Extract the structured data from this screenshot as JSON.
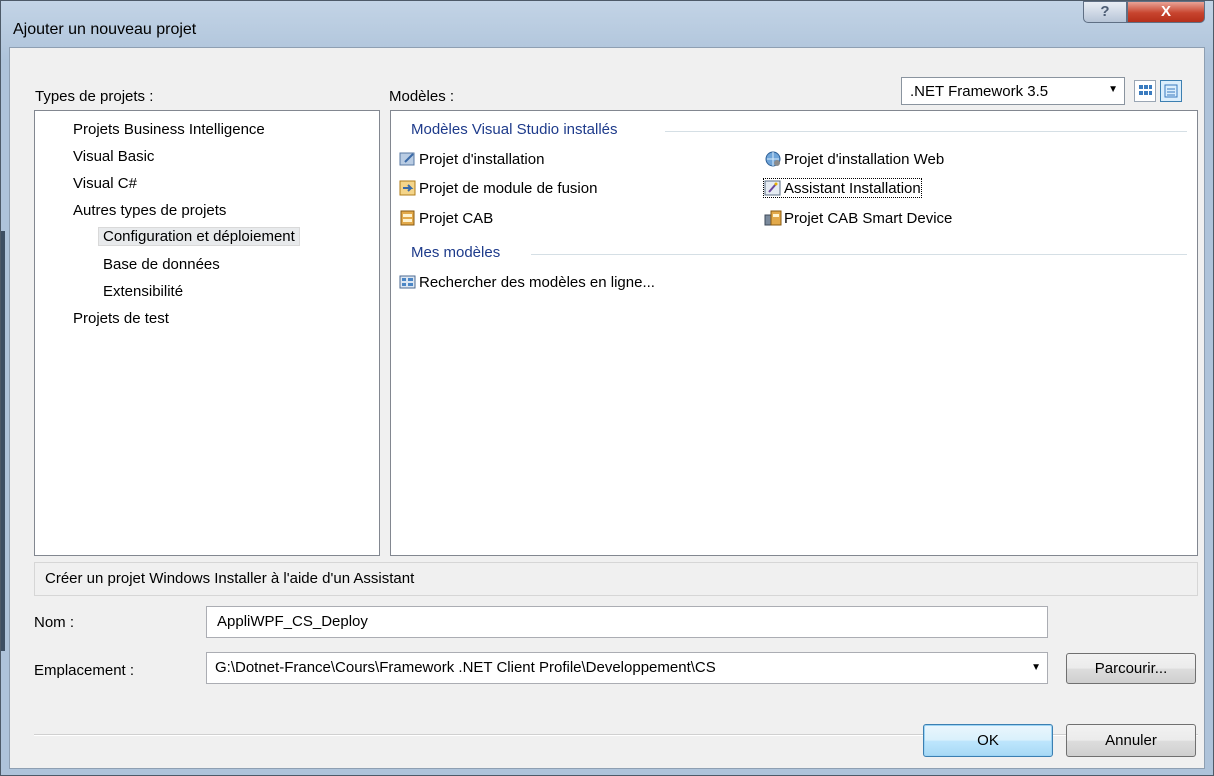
{
  "window": {
    "title": "Ajouter un nouveau projet"
  },
  "caption": {
    "help_glyph": "?",
    "close_glyph": "X"
  },
  "project_types": {
    "label": "Types de projets :",
    "items": [
      {
        "label": "Projets Business Intelligence"
      },
      {
        "label": "Visual Basic"
      },
      {
        "label": "Visual C#"
      },
      {
        "label": "Autres types de projets"
      },
      {
        "label": "Configuration et déploiement",
        "selected": true
      },
      {
        "label": "Base de données"
      },
      {
        "label": "Extensibilité"
      },
      {
        "label": "Projets de test"
      }
    ]
  },
  "templates": {
    "label": "Modèles :",
    "framework": ".NET Framework 3.5",
    "installed_header": "Modèles Visual Studio installés",
    "installed": [
      {
        "label": "Projet d'installation",
        "icon": "installer-project-icon"
      },
      {
        "label": "Projet d'installation Web",
        "icon": "web-setup-icon"
      },
      {
        "label": "Projet de module de fusion",
        "icon": "merge-module-icon"
      },
      {
        "label": "Assistant Installation",
        "icon": "setup-wizard-icon",
        "selected": true
      },
      {
        "label": "Projet CAB",
        "icon": "cab-project-icon"
      },
      {
        "label": "Projet CAB Smart Device",
        "icon": "smart-device-cab-icon"
      }
    ],
    "my_header": "Mes modèles",
    "my": [
      {
        "label": "Rechercher des modèles en ligne...",
        "icon": "online-templates-icon"
      }
    ]
  },
  "description": "Créer un projet Windows Installer à l'aide d'un Assistant",
  "form": {
    "name_label": "Nom :",
    "name_value": "AppliWPF_CS_Deploy",
    "location_label": "Emplacement :",
    "location_value": "G:\\Dotnet-France\\Cours\\Framework .NET Client Profile\\Developpement\\CS",
    "browse_label": "Parcourir..."
  },
  "buttons": {
    "ok": "OK",
    "cancel": "Annuler"
  },
  "colors": {
    "group_header": "#1e3b8b",
    "close_button": "#c7442e",
    "default_button": "#3c7fb1"
  }
}
